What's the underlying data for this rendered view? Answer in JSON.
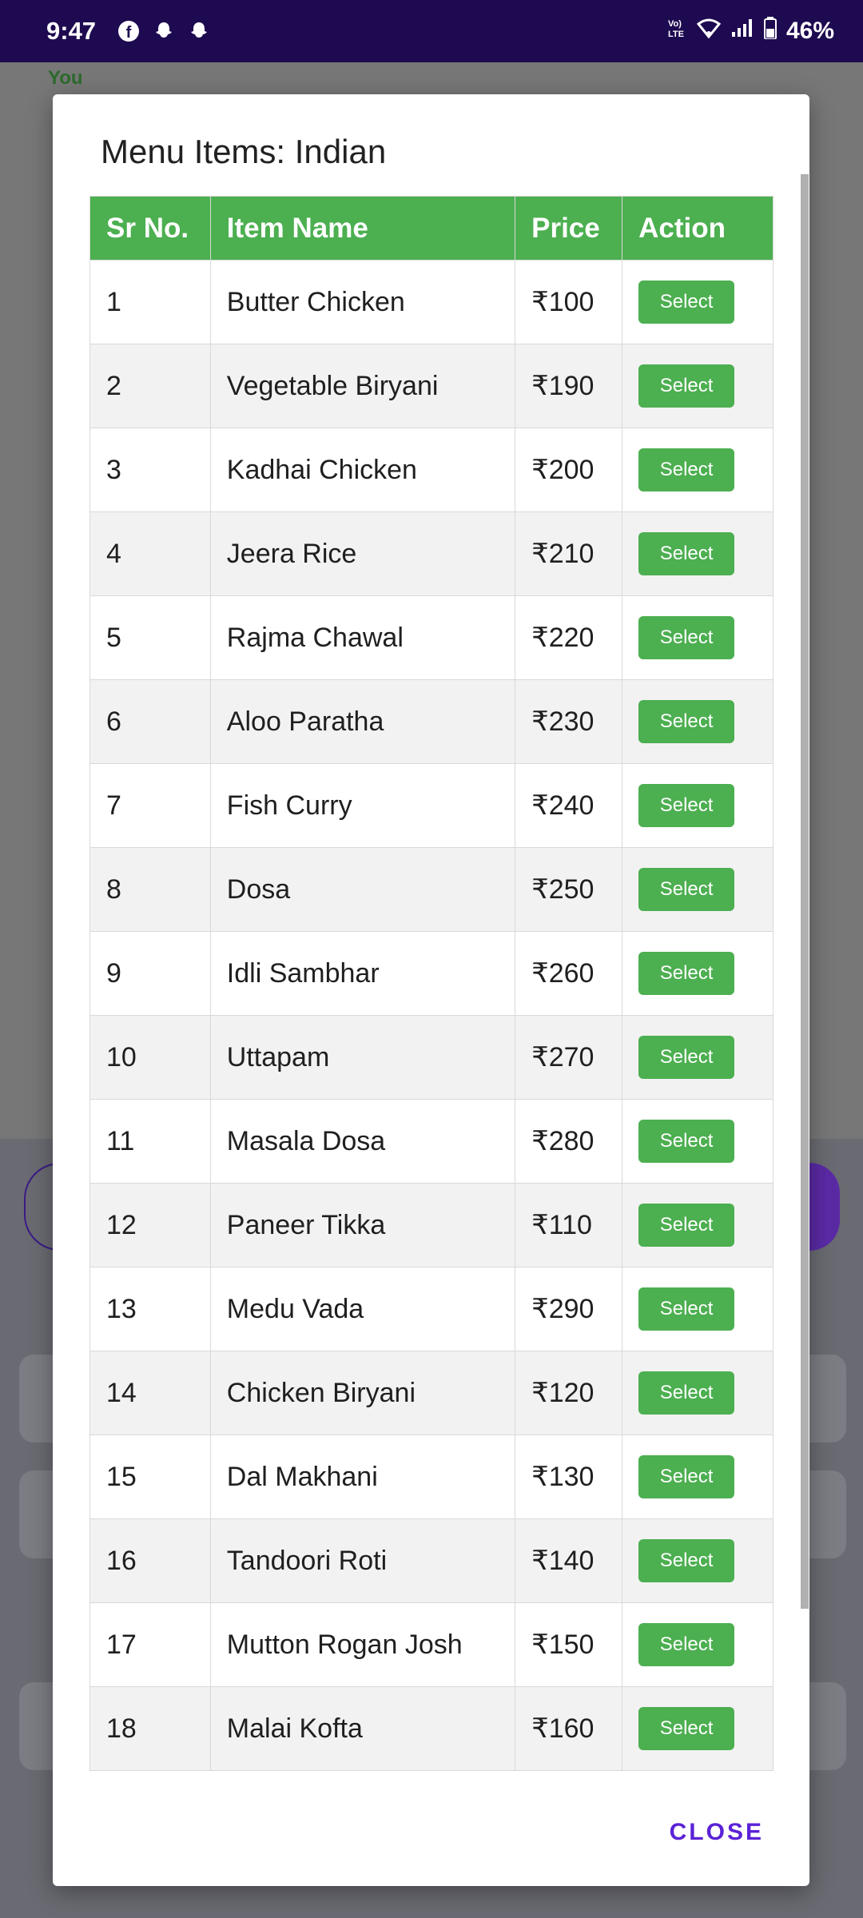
{
  "status_bar": {
    "time": "9:47",
    "battery": "46%",
    "notification_icons": [
      "facebook-icon",
      "snapchat-icon",
      "snapchat-icon"
    ],
    "right_icons": [
      "volte-icon",
      "wifi-icon",
      "signal-icon",
      "battery-icon"
    ]
  },
  "background": {
    "you_label": "You"
  },
  "dialog": {
    "title": "Menu Items: Indian",
    "columns": [
      "Sr No.",
      "Item Name",
      "Price",
      "Action"
    ],
    "items": [
      {
        "sr": "1",
        "name": "Butter Chicken",
        "price": "₹100",
        "action": "Select"
      },
      {
        "sr": "2",
        "name": "Vegetable Biryani",
        "price": "₹190",
        "action": "Select"
      },
      {
        "sr": "3",
        "name": "Kadhai Chicken",
        "price": "₹200",
        "action": "Select"
      },
      {
        "sr": "4",
        "name": "Jeera Rice",
        "price": "₹210",
        "action": "Select"
      },
      {
        "sr": "5",
        "name": "Rajma Chawal",
        "price": "₹220",
        "action": "Select"
      },
      {
        "sr": "6",
        "name": "Aloo Paratha",
        "price": "₹230",
        "action": "Select"
      },
      {
        "sr": "7",
        "name": "Fish Curry",
        "price": "₹240",
        "action": "Select"
      },
      {
        "sr": "8",
        "name": "Dosa",
        "price": "₹250",
        "action": "Select"
      },
      {
        "sr": "9",
        "name": "Idli Sambhar",
        "price": "₹260",
        "action": "Select"
      },
      {
        "sr": "10",
        "name": "Uttapam",
        "price": "₹270",
        "action": "Select"
      },
      {
        "sr": "11",
        "name": "Masala Dosa",
        "price": "₹280",
        "action": "Select"
      },
      {
        "sr": "12",
        "name": "Paneer Tikka",
        "price": "₹110",
        "action": "Select"
      },
      {
        "sr": "13",
        "name": "Medu Vada",
        "price": "₹290",
        "action": "Select"
      },
      {
        "sr": "14",
        "name": "Chicken Biryani",
        "price": "₹120",
        "action": "Select"
      },
      {
        "sr": "15",
        "name": "Dal Makhani",
        "price": "₹130",
        "action": "Select"
      },
      {
        "sr": "16",
        "name": "Tandoori Roti",
        "price": "₹140",
        "action": "Select"
      },
      {
        "sr": "17",
        "name": "Mutton Rogan Josh",
        "price": "₹150",
        "action": "Select"
      },
      {
        "sr": "18",
        "name": "Malai Kofta",
        "price": "₹160",
        "action": "Select"
      }
    ],
    "close_label": "CLOSE"
  },
  "colors": {
    "status_bar": "#1e0a50",
    "header_green": "#4caf50",
    "select_green": "#4caf50",
    "close_purple": "#5b22d6"
  }
}
